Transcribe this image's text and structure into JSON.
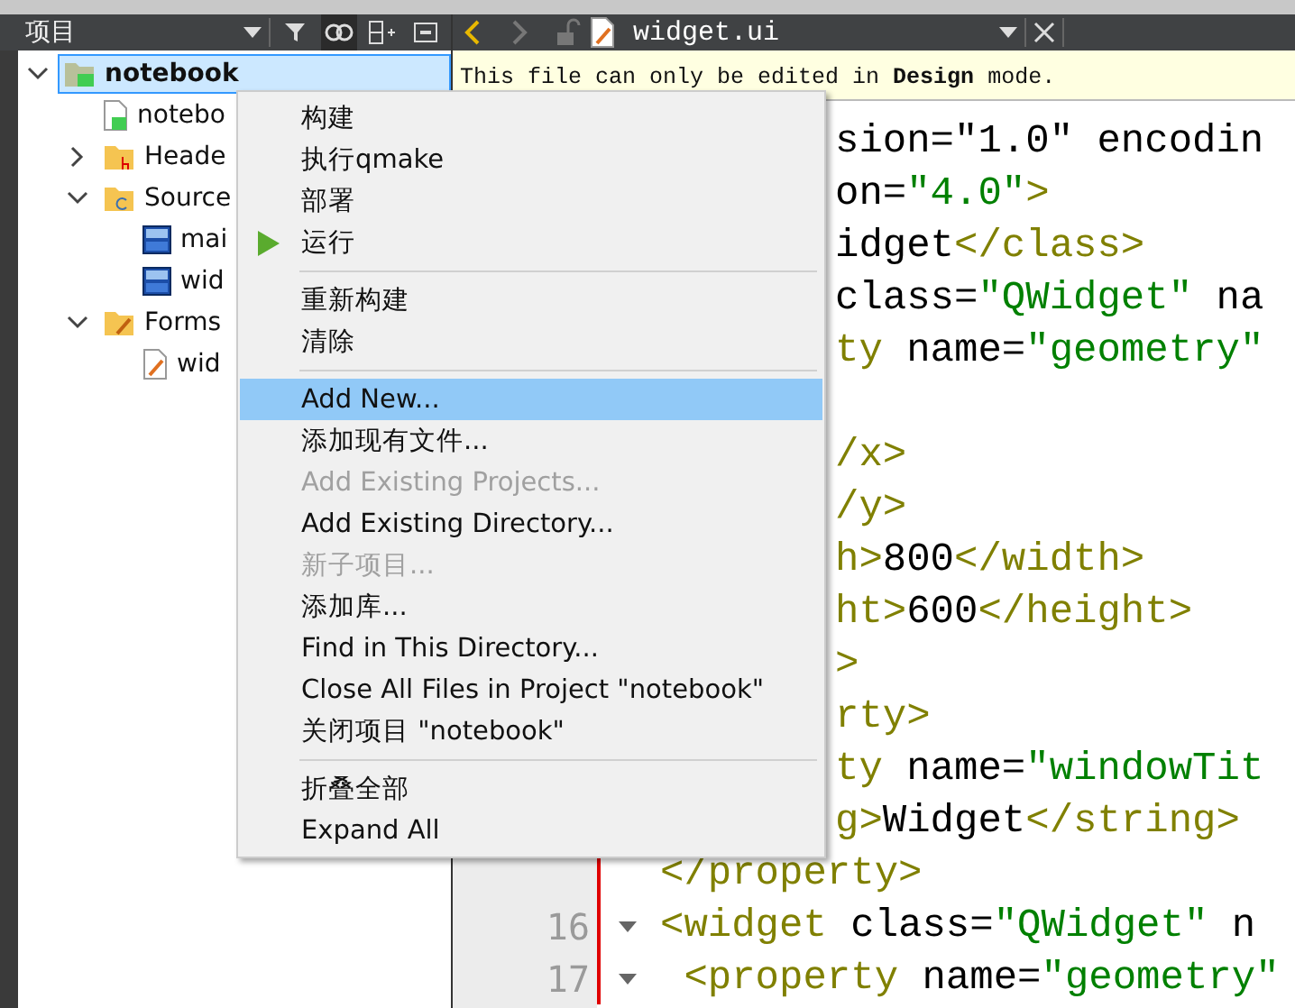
{
  "sidebar": {
    "title": "项目",
    "tree": [
      {
        "label": "notebook",
        "kind": "project",
        "selected": true,
        "expanded": true,
        "children": [
          {
            "label": "notebo",
            "kind": "profile",
            "selected": false
          },
          {
            "label": "Heade",
            "kind": "headers",
            "selected": false,
            "expanded": false
          },
          {
            "label": "Source",
            "kind": "sources",
            "selected": false,
            "expanded": true,
            "children": [
              {
                "label": "mai",
                "kind": "cpp",
                "selected": false
              },
              {
                "label": "wid",
                "kind": "cpp",
                "selected": false
              }
            ]
          },
          {
            "label": "Forms",
            "kind": "forms",
            "selected": false,
            "expanded": true,
            "children": [
              {
                "label": "wid",
                "kind": "form",
                "selected": false
              }
            ]
          }
        ]
      }
    ]
  },
  "editor": {
    "tab": {
      "filename": "widget.ui"
    },
    "info": "This file can only be edited in **Design** mode.",
    "lines": [
      {
        "kind": "covered",
        "segments": [
          {
            "text": "sion=\"1.0\" encodin",
            "kind": "text"
          }
        ]
      },
      {
        "kind": "covered",
        "segments": [
          {
            "text": "on=",
            "kind": "text"
          },
          {
            "text": "\"4.0\"",
            "kind": "value"
          },
          {
            "text": ">",
            "kind": "tag"
          }
        ]
      },
      {
        "kind": "covered",
        "segments": [
          {
            "text": "idget",
            "kind": "text"
          },
          {
            "text": "</class>",
            "kind": "tag"
          }
        ]
      },
      {
        "kind": "covered",
        "segments": [
          {
            "text": "class=",
            "kind": "text"
          },
          {
            "text": "\"QWidget\"",
            "kind": "value"
          },
          {
            "text": " na",
            "kind": "text"
          }
        ]
      },
      {
        "kind": "covered",
        "segments": [
          {
            "text": "ty",
            "kind": "tag"
          },
          {
            "text": " name=",
            "kind": "text"
          },
          {
            "text": "\"geometry\"",
            "kind": "value"
          }
        ]
      },
      {
        "kind": "covered"
      },
      {
        "kind": "covered",
        "segments": [
          {
            "text": "/x>",
            "kind": "tag"
          }
        ]
      },
      {
        "kind": "covered",
        "segments": [
          {
            "text": "/y>",
            "kind": "tag"
          }
        ]
      },
      {
        "kind": "covered",
        "segments": [
          {
            "text": "h>",
            "kind": "tag"
          },
          {
            "text": "800",
            "kind": "text"
          },
          {
            "text": "</width>",
            "kind": "tag"
          }
        ]
      },
      {
        "kind": "covered",
        "segments": [
          {
            "text": "ht>",
            "kind": "tag"
          },
          {
            "text": "600",
            "kind": "text"
          },
          {
            "text": "</height>",
            "kind": "tag"
          }
        ]
      },
      {
        "kind": "covered",
        "segments": [
          {
            "text": ">",
            "kind": "tag"
          }
        ]
      },
      {
        "kind": "covered",
        "segments": [
          {
            "text": "rty>",
            "kind": "tag"
          }
        ]
      },
      {
        "kind": "covered",
        "segments": [
          {
            "text": "ty",
            "kind": "tag"
          },
          {
            "text": " name=",
            "kind": "text"
          },
          {
            "text": "\"windowTit",
            "kind": "value"
          }
        ]
      },
      {
        "kind": "covered",
        "segments": [
          {
            "text": "g>",
            "kind": "tag"
          },
          {
            "text": "Widget",
            "kind": "text"
          },
          {
            "text": "</string>",
            "kind": "tag"
          }
        ]
      },
      {
        "kind": "full",
        "segments": [
          {
            "text": "</property>",
            "kind": "tag"
          }
        ]
      },
      {
        "kind": "full",
        "number": "16",
        "foldable": true,
        "segments": [
          {
            "text": "<widget",
            "kind": "tag"
          },
          {
            "text": " class=",
            "kind": "text"
          },
          {
            "text": "\"QWidget\"",
            "kind": "value"
          },
          {
            "text": " n",
            "kind": "text"
          }
        ]
      },
      {
        "kind": "full",
        "number": "17",
        "foldable": true,
        "segments": [
          {
            "text": " <property",
            "kind": "tag"
          },
          {
            "text": " name=",
            "kind": "text"
          },
          {
            "text": "\"geometry\"",
            "kind": "value"
          }
        ]
      }
    ]
  },
  "context_menu": {
    "items": [
      {
        "kind": "item",
        "label": "构建",
        "disabled": false,
        "selected": false
      },
      {
        "kind": "item",
        "label": "执行qmake",
        "disabled": false,
        "selected": false
      },
      {
        "kind": "item",
        "label": "部署",
        "disabled": false,
        "selected": false
      },
      {
        "kind": "run",
        "label": "运行",
        "disabled": false,
        "selected": false
      },
      {
        "kind": "separator"
      },
      {
        "kind": "item",
        "label": "重新构建",
        "disabled": false,
        "selected": false
      },
      {
        "kind": "item",
        "label": "清除",
        "disabled": false,
        "selected": false
      },
      {
        "kind": "separator"
      },
      {
        "kind": "item",
        "label": "Add New...",
        "disabled": false,
        "selected": true
      },
      {
        "kind": "item",
        "label": "添加现有文件...",
        "disabled": false,
        "selected": false
      },
      {
        "kind": "item",
        "label": "Add Existing Projects...",
        "disabled": true,
        "selected": false
      },
      {
        "kind": "item",
        "label": "Add Existing Directory...",
        "disabled": false,
        "selected": false
      },
      {
        "kind": "item",
        "label": "新子项目...",
        "disabled": true,
        "selected": false
      },
      {
        "kind": "item",
        "label": "添加库...",
        "disabled": false,
        "selected": false
      },
      {
        "kind": "item",
        "label": "Find in This Directory...",
        "disabled": false,
        "selected": false
      },
      {
        "kind": "item",
        "label": "Close All Files in Project \"notebook\"",
        "disabled": false,
        "selected": false
      },
      {
        "kind": "item",
        "label": "关闭项目 \"notebook\"",
        "disabled": false,
        "selected": false
      },
      {
        "kind": "separator"
      },
      {
        "kind": "item",
        "label": "折叠全部",
        "disabled": false,
        "selected": false
      },
      {
        "kind": "item",
        "label": "Expand All",
        "disabled": false,
        "selected": false
      }
    ]
  }
}
